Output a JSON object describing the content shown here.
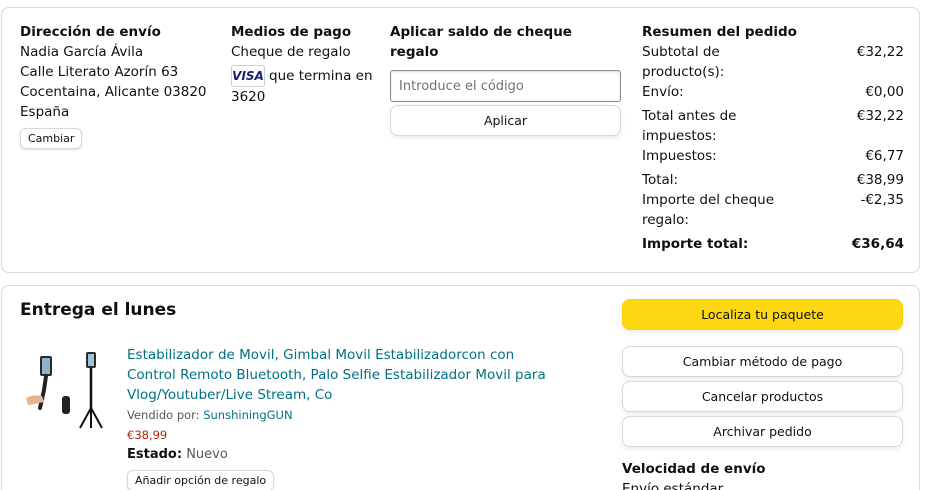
{
  "shipping": {
    "heading": "Dirección de envío",
    "name": "Nadia García Ávila",
    "street": "Calle Literato Azorín 63",
    "city": "Cocentaina, Alicante 03820",
    "country": "España",
    "change_label": "Cambiar"
  },
  "payment": {
    "heading": "Medios de pago",
    "method": "Cheque de regalo",
    "card_brand": "VISA",
    "card_text": "que termina en 3620"
  },
  "gift_card": {
    "heading": "Aplicar saldo de cheque regalo",
    "placeholder": "Introduce el código",
    "apply_label": "Aplicar"
  },
  "order_summary": {
    "heading": "Resumen del pedido",
    "rows": [
      {
        "label": "Subtotal de producto(s):",
        "value": "€32,22"
      },
      {
        "label": "Envío:",
        "value": "€0,00"
      },
      {
        "label": "Total antes de impuestos:",
        "value": "€32,22"
      },
      {
        "label": "Impuestos:",
        "value": "€6,77"
      },
      {
        "label": "Total:",
        "value": "€38,99"
      },
      {
        "label": "Importe del cheque regalo:",
        "value": "-€2,35"
      }
    ],
    "grand_total_label": "Importe total:",
    "grand_total_value": "€36,64"
  },
  "delivery": {
    "title": "Entrega el lunes",
    "product": {
      "title": "Estabilizador de Movil, Gimbal Movil Estabilizadorcon con Control Remoto Bluetooth, Palo Selfie Estabilizador Movil para Vlog/Youtuber/Live Stream, Co",
      "seller_prefix": "Vendido por:",
      "seller_name": "SunshiningGUN",
      "price": "€38,99",
      "condition_label": "Estado:",
      "condition_value": "Nuevo",
      "gift_option_label": "Añadir opción de regalo"
    },
    "actions": {
      "track": "Localiza tu paquete",
      "change_payment": "Cambiar método de pago",
      "cancel": "Cancelar productos",
      "archive": "Archivar pedido"
    },
    "speed_heading": "Velocidad de envío",
    "speed_value": "Envío estándar"
  },
  "colors": {
    "link": "#007185",
    "price": "#b12704",
    "primary_button": "#ffd814",
    "border": "#d5d9d9"
  }
}
